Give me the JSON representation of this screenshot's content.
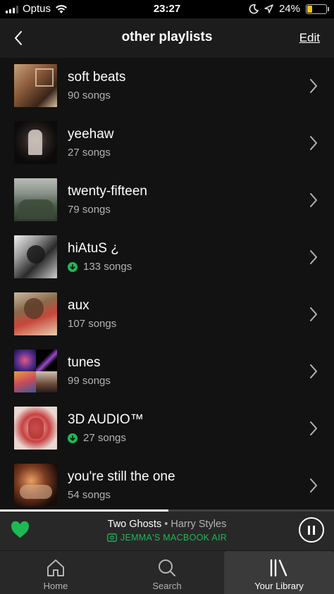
{
  "status_bar": {
    "carrier": "Optus",
    "time": "23:27",
    "battery_percent": "24%",
    "battery_level": 0.24,
    "battery_color": "#f4c20d",
    "icons": [
      "signal-icon",
      "wifi-icon",
      "moon-icon",
      "location-icon",
      "battery-icon"
    ]
  },
  "nav": {
    "back_icon": "chevron-left-icon",
    "title": "other playlists",
    "edit_label": "Edit"
  },
  "playlists": [
    {
      "title": "soft beats",
      "subtitle": "90 songs",
      "downloaded": false
    },
    {
      "title": "yeehaw",
      "subtitle": "27 songs",
      "downloaded": false
    },
    {
      "title": "twenty-fifteen",
      "subtitle": "79 songs",
      "downloaded": false
    },
    {
      "title": "hiAtuS ¿",
      "subtitle": "133 songs",
      "downloaded": true
    },
    {
      "title": "aux",
      "subtitle": "107 songs",
      "downloaded": false
    },
    {
      "title": "tunes",
      "subtitle": "99 songs",
      "downloaded": false
    },
    {
      "title": "3D AUDIO™",
      "subtitle": "27 songs",
      "downloaded": true
    },
    {
      "title": "you're still the one",
      "subtitle": "54 songs",
      "downloaded": false
    }
  ],
  "now_playing": {
    "track": "Two Ghosts",
    "separator": " • ",
    "artist": "Harry Styles",
    "device": "JEMMA'S MACBOOK AIR",
    "progress": 0.505,
    "liked": true,
    "accent_color": "#1db954"
  },
  "tabs": [
    {
      "label": "Home",
      "icon": "home-icon",
      "active": false
    },
    {
      "label": "Search",
      "icon": "search-icon",
      "active": false
    },
    {
      "label": "Your Library",
      "icon": "library-icon",
      "active": true
    }
  ]
}
